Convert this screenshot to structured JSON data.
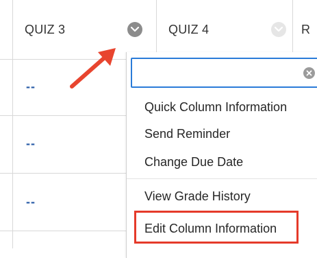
{
  "columns": [
    {
      "label": "QUIZ 3"
    },
    {
      "label": "QUIZ 4"
    },
    {
      "label": "R"
    }
  ],
  "rows": [
    {
      "quiz3": "--"
    },
    {
      "quiz3": "--"
    },
    {
      "quiz3": "--"
    }
  ],
  "menu": {
    "search_value": "",
    "items": [
      {
        "label": "Quick Column Information"
      },
      {
        "label": "Send Reminder"
      },
      {
        "label": "Change Due Date"
      },
      {
        "label": "View Grade History"
      },
      {
        "label": "Edit Column Information"
      }
    ]
  },
  "annotation": {
    "arrow_color": "#e8452f",
    "highlight_color": "#e53a2a",
    "highlighted_item": "Edit Column Information"
  },
  "icons": {
    "column_menu": "chevron-down-icon",
    "clear": "close-icon",
    "annotation": "arrow-icon"
  }
}
